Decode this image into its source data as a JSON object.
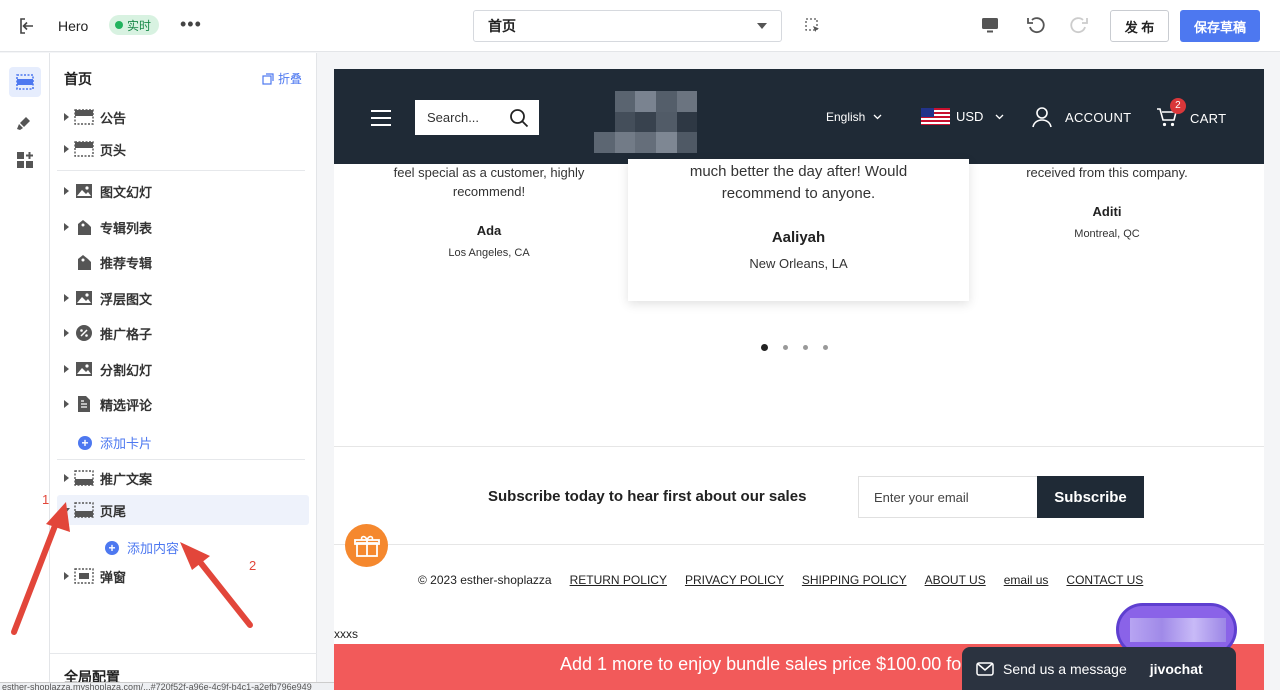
{
  "topbar": {
    "app_title": "Hero",
    "live_label": "实时",
    "more_label": "•••",
    "page_select_value": "首页",
    "publish_label": "发 布",
    "save_label": "保存草稿"
  },
  "panel": {
    "title": "首页",
    "collapse_label": "折叠",
    "sections": [
      {
        "label": "公告",
        "icon": "section-icon"
      },
      {
        "label": "页头",
        "icon": "section-icon"
      },
      {
        "label": "图文幻灯",
        "icon": "image-icon"
      },
      {
        "label": "专辑列表",
        "icon": "tag-icon"
      },
      {
        "label": "推荐专辑",
        "icon": "tag-icon"
      },
      {
        "label": "浮层图文",
        "icon": "image-icon"
      },
      {
        "label": "推广格子",
        "icon": "percent-icon"
      },
      {
        "label": "分割幻灯",
        "icon": "image-icon"
      },
      {
        "label": "精选评论",
        "icon": "document-icon"
      }
    ],
    "add_card_label": "添加卡片",
    "footer_sections": [
      {
        "label": "推广文案",
        "icon": "section-icon"
      },
      {
        "label": "页尾",
        "icon": "section-icon"
      }
    ],
    "add_content_label": "添加内容",
    "popup_label": "弹窗",
    "global_config_label": "全局配置",
    "status_url": "esther-shoplazza.myshoplaza.com/...#720f52f-a96e-4c9f-b4c1-a2efb796e949"
  },
  "annotations": {
    "one": "1",
    "two": "2"
  },
  "store": {
    "search_placeholder": "Search...",
    "language": "English",
    "currency": "USD",
    "account_label": "ACCOUNT",
    "cart_label": "CART",
    "cart_count": "2",
    "reviews": [
      {
        "text": "feel special as a customer, highly recommend!",
        "name": "Ada",
        "location": "Los Angeles, CA"
      },
      {
        "text": "much better the day after! Would recommend to anyone.",
        "name": "Aaliyah",
        "location": "New Orleans, LA"
      },
      {
        "text": "received from this company.",
        "name": "Aditi",
        "location": "Montreal, QC"
      }
    ],
    "carousel_dots": 4,
    "carousel_active": 1,
    "subscribe_text": "Subscribe today to hear first about our sales",
    "email_placeholder": "Enter your email",
    "subscribe_button": "Subscribe",
    "copyright": "© 2023 esther-shoplazza",
    "footer_links": [
      "RETURN POLICY",
      "PRIVACY POLICY",
      "SHIPPING POLICY",
      "ABOUT US",
      "email us",
      "CONTACT US"
    ],
    "extra_text": "xxxs",
    "promo_text": "Add 1 more to enjoy bundle sales price $100.00 for",
    "chat_label": "Send us a message",
    "chat_brand": "jivochat"
  },
  "colors": {
    "accent": "#4d78f0",
    "store_header": "#1f2a36",
    "promo": "#f25a5a",
    "annotation": "#e2463a"
  }
}
